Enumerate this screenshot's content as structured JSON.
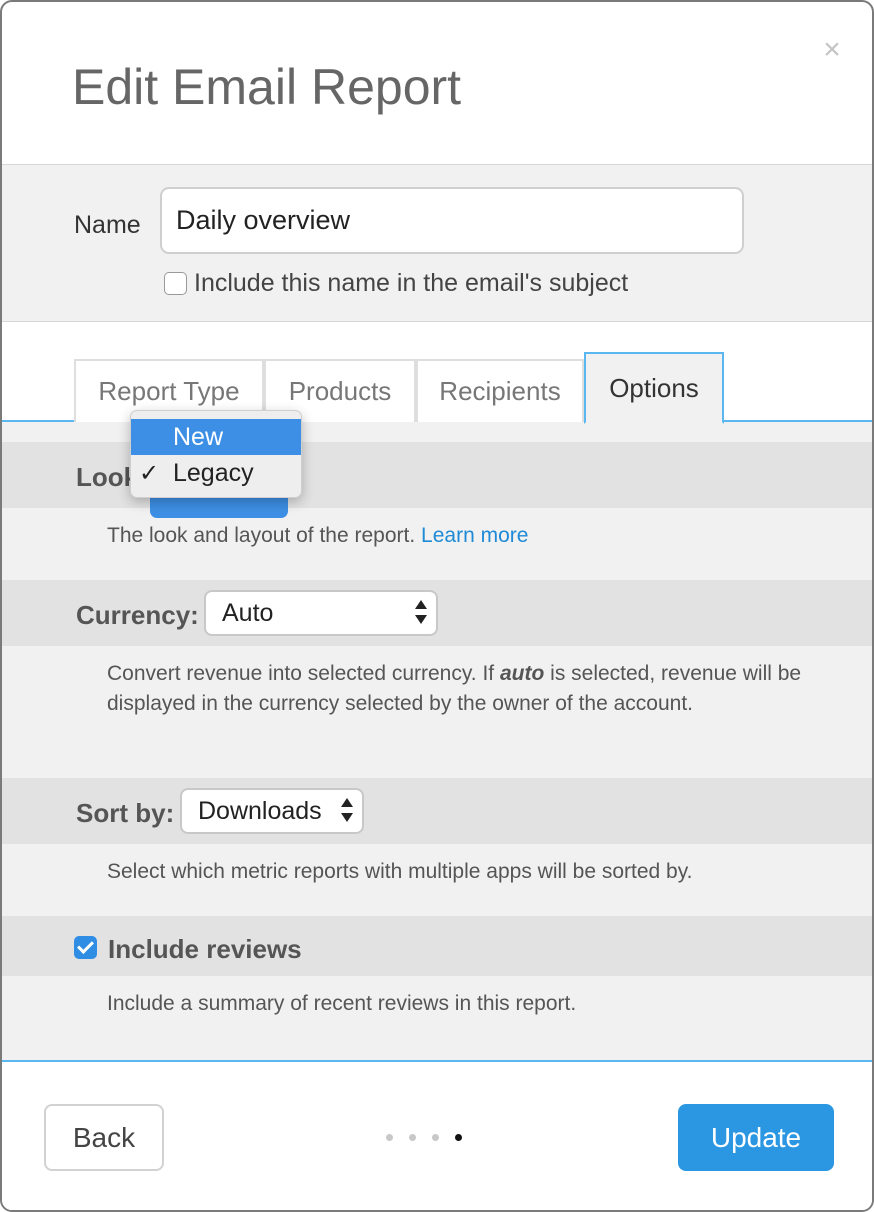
{
  "modal": {
    "title": "Edit Email Report",
    "close_glyph": "×"
  },
  "name_section": {
    "label": "Name",
    "value": "Daily overview",
    "include_subject_label": "Include this name in the email's subject",
    "include_subject_checked": false
  },
  "tabs": [
    {
      "label": "Report Type",
      "active": false
    },
    {
      "label": "Products",
      "active": false
    },
    {
      "label": "Recipients",
      "active": false
    },
    {
      "label": "Options",
      "active": true
    }
  ],
  "options": {
    "look": {
      "label": "Look",
      "description": "The look and layout of the report.",
      "learn_more": "Learn more",
      "dropdown": {
        "items": [
          {
            "label": "New",
            "highlighted": true,
            "checked": false
          },
          {
            "label": "Legacy",
            "highlighted": false,
            "checked": true
          }
        ],
        "check_glyph": "✓"
      }
    },
    "currency": {
      "label": "Currency:",
      "value": "Auto",
      "description_pre": "Convert revenue into selected currency. If ",
      "description_em": "auto",
      "description_post": " is selected, revenue will be displayed in the currency selected by the owner of the account."
    },
    "sort": {
      "label": "Sort by:",
      "value": "Downloads",
      "description": "Select which metric reports with multiple apps will be sorted by."
    },
    "reviews": {
      "label": "Include reviews",
      "checked": true,
      "description": "Include a summary of recent reviews in this report."
    }
  },
  "footer": {
    "back_label": "Back",
    "update_label": "Update",
    "steps_total": 4,
    "current_step": 4
  },
  "colors": {
    "accent": "#2b97e3",
    "link": "#1f8ad6",
    "tab_border": "#5ab7f0",
    "highlight": "#3d8fe5"
  }
}
